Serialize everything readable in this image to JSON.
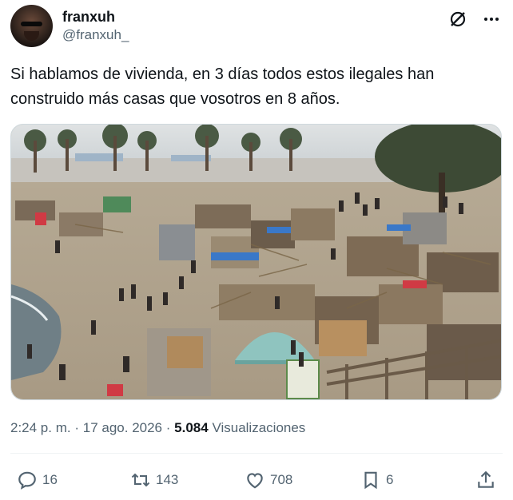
{
  "author": {
    "display_name": "franxuh",
    "handle": "@franxuh_"
  },
  "icons": {
    "grok": "grok-icon",
    "more": "more-icon",
    "reply": "reply-icon",
    "retweet": "retweet-icon",
    "like": "like-icon",
    "bookmark": "bookmark-icon",
    "share": "share-icon"
  },
  "tweet": {
    "text": "Si hablamos de vivienda, en 3 días todos estos ilegales han\nconstruido más casas que vosotros en 8 años."
  },
  "meta": {
    "time": "2:24 p. m.",
    "separator": "·",
    "date": "17 ago. 2026",
    "views_count": "5.084",
    "views_label": "Visualizaciones"
  },
  "actions": {
    "replies": "16",
    "retweets": "143",
    "likes": "708",
    "bookmarks": "6"
  },
  "colors": {
    "text": "#0f1419",
    "secondary": "#536471",
    "divider": "#eff3f4"
  }
}
